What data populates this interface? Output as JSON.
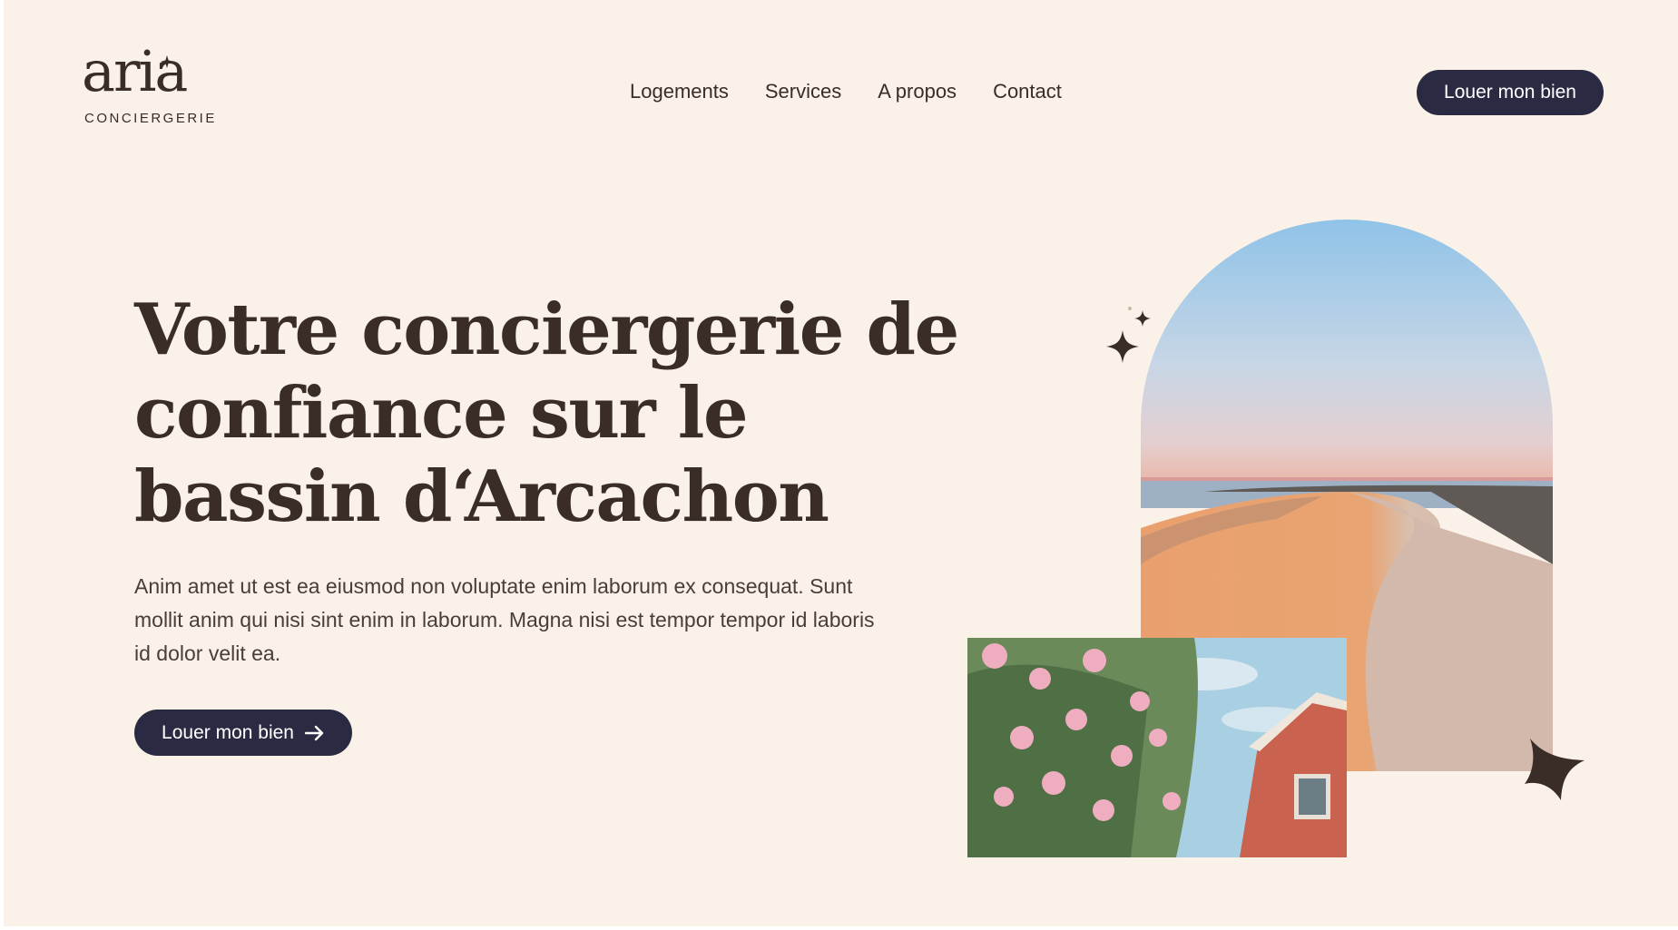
{
  "brand": {
    "logo_word": "aria",
    "logo_sub": "CONCIERGERIE"
  },
  "nav": {
    "items": [
      {
        "label": "Logements"
      },
      {
        "label": "Services"
      },
      {
        "label": "A propos"
      },
      {
        "label": "Contact"
      }
    ],
    "cta_label": "Louer mon bien"
  },
  "hero": {
    "title_lines": [
      "Votre conciergerie de",
      "confiance sur le",
      "bassin d‘Arcachon"
    ],
    "description": "Anim amet ut est ea eiusmod non voluptate enim laborum ex consequat. Sunt mollit anim qui nisi sint enim in laborum. Magna nisi est tempor tempor id laboris id dolor velit ea.",
    "cta_label": "Louer mon bien",
    "cta_icon": "arrow-right-icon"
  },
  "colors": {
    "background": "#faf1e8",
    "text": "#3a2d28",
    "button": "#2a2b43",
    "button_text": "#ffffff"
  },
  "icons": [
    "sparkle-icon",
    "four-point-star-icon",
    "arrow-right-icon"
  ]
}
